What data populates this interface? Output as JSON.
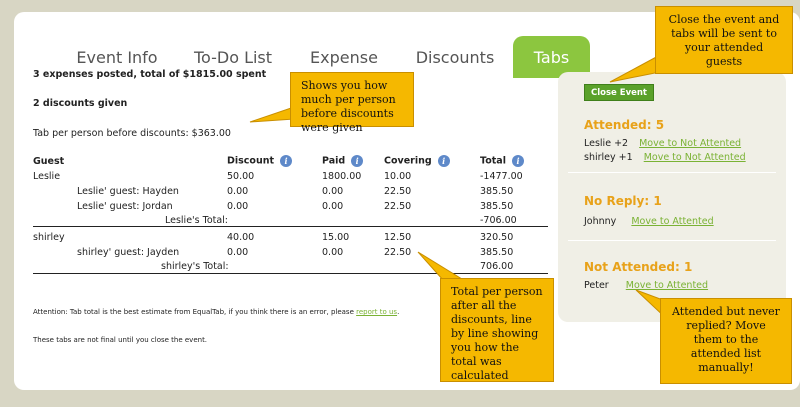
{
  "tabs": [
    {
      "label": "Event Info"
    },
    {
      "label": "To-Do List"
    },
    {
      "label": "Expense"
    },
    {
      "label": "Discounts"
    },
    {
      "label": "Tabs"
    }
  ],
  "summary": {
    "expenses": "3 expenses posted, total of $1815.00 spent",
    "discounts": "2 discounts given",
    "tab_per_person": "Tab per person before discounts: $363.00"
  },
  "table": {
    "headers": {
      "guest": "Guest",
      "discount": "Discount",
      "paid": "Paid",
      "covering": "Covering",
      "total": "Total"
    },
    "groups": [
      {
        "rows": [
          {
            "name": "Leslie",
            "discount": "50.00",
            "paid": "1800.00",
            "covering": "10.00",
            "total": "-1477.00"
          },
          {
            "name": "Leslie' guest: Hayden",
            "discount": "0.00",
            "paid": "0.00",
            "covering": "22.50",
            "total": "385.50"
          },
          {
            "name": "Leslie' guest: Jordan",
            "discount": "0.00",
            "paid": "0.00",
            "covering": "22.50",
            "total": "385.50"
          }
        ],
        "total_label": "Leslie's Total:",
        "total_value": "-706.00"
      },
      {
        "rows": [
          {
            "name": "shirley",
            "discount": "40.00",
            "paid": "15.00",
            "covering": "12.50",
            "total": "320.50"
          },
          {
            "name": "shirley' guest: Jayden",
            "discount": "0.00",
            "paid": "0.00",
            "covering": "22.50",
            "total": "385.50"
          }
        ],
        "total_label": "shirley's Total:",
        "total_value": "706.00"
      }
    ]
  },
  "footer": {
    "attention_prefix": "Attention: Tab total is the best estimate from EqualTab, if you think there is an error, please ",
    "attention_link": "report to us",
    "attention_suffix": ".",
    "not_final": "These tabs are not final until you close the event."
  },
  "sidebar": {
    "close_button": "Close Event",
    "attended_title": "Attended: 5",
    "attended": [
      {
        "name": "Leslie +2",
        "action": "Move to Not Attented"
      },
      {
        "name": "shirley +1",
        "action": "Move to Not Attented"
      }
    ],
    "noreply_title": "No Reply: 1",
    "noreply": [
      {
        "name": "Johnny",
        "action": "Move to Attented"
      }
    ],
    "notattended_title": "Not Attended: 1",
    "notattended": [
      {
        "name": "Peter",
        "action": "Move to Attented"
      }
    ]
  },
  "notes": {
    "close_event": "Close the event and tabs will be sent to your attended guests",
    "per_person": "Shows you how much per person before discounts were given",
    "total_per_person": "Total per person after all the discounts, line by line showing you how the total was calculated",
    "attended_never_replied": "Attended but never replied? Move them to the attended list manually!"
  },
  "colors": {
    "accent_green": "#8cc63f",
    "button_green": "#5aa12a",
    "section_orange": "#e8a21a",
    "note_yellow": "#f5b800",
    "info_blue": "#5e89c9"
  }
}
